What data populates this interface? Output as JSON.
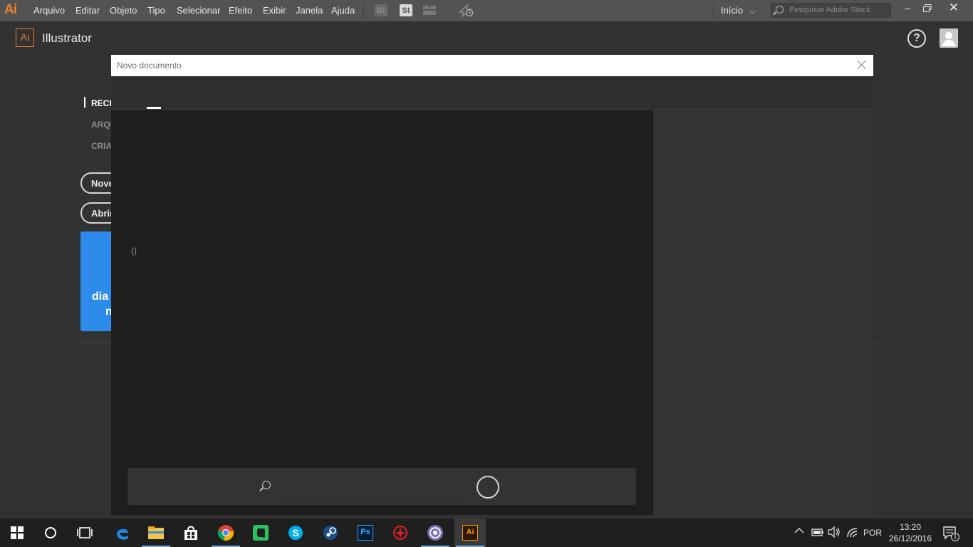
{
  "menubar": {
    "app_logo": "Ai",
    "menus": [
      "Arquivo",
      "Editar",
      "Objeto",
      "Tipo",
      "Selecionar",
      "Efeito",
      "Exibir",
      "Janela",
      "Ajuda"
    ],
    "bridge_label": "Br",
    "stock_label": "St",
    "workspace": "Início",
    "search_placeholder": "Pesquisar Adobe Stock"
  },
  "header": {
    "logo": "Ai",
    "title": "Illustrator",
    "help": "?"
  },
  "start_screen": {
    "nav": [
      "RECE",
      "ARQU",
      "CRIA"
    ],
    "new_button": "Nove",
    "open_button": "Abrir",
    "promo_lines": [
      "dia",
      "n"
    ]
  },
  "dialog": {
    "title": "Novo documento",
    "empty_parens": "()",
    "search_value": ""
  },
  "taskbar": {
    "apps": [
      "edge-icon",
      "file-explorer-icon",
      "store-icon",
      "chrome-icon",
      "evernote-icon",
      "skype-icon",
      "steam-icon",
      "photoshop-icon",
      "app-icon",
      "bittorrent-icon",
      "illustrator-icon"
    ],
    "photoshop_label": "Ps",
    "illustrator_label": "Ai",
    "language": "POR",
    "time": "13:20",
    "date": "26/12/2016",
    "notifications": "1"
  }
}
